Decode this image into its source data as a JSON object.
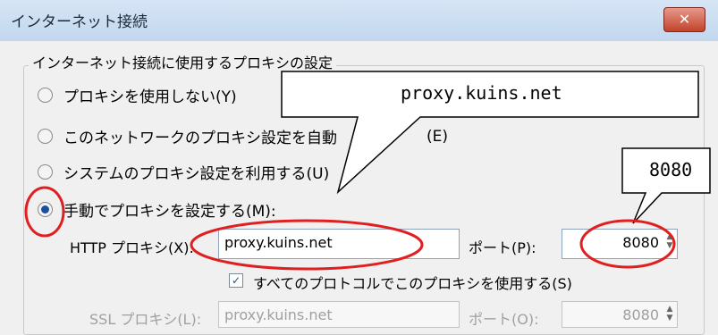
{
  "window": {
    "title": "インターネット接続",
    "close_glyph": "✕"
  },
  "group": {
    "title": "インターネット接続に使用するプロキシの設定"
  },
  "options": [
    {
      "label": "プロキシを使用しない(Y)",
      "checked": false
    },
    {
      "label": "このネットワークのプロキシ設定を自動",
      "trailing": "(E)",
      "checked": false
    },
    {
      "label": "システムのプロキシ設定を利用する(U)",
      "checked": false
    },
    {
      "label": "手動でプロキシを設定する(M):",
      "checked": true
    }
  ],
  "http": {
    "label": "HTTP プロキシ(X):",
    "host": "proxy.kuins.net",
    "port_label": "ポート(P):",
    "port": "8080"
  },
  "all_protocols": {
    "label": "すべてのプロトコルでこのプロキシを使用する(S)",
    "checked": true,
    "check_glyph": "✓"
  },
  "ssl": {
    "label": "SSL プロキシ(L):",
    "host": "proxy.kuins.net",
    "port_label": "ポート(O):",
    "port": "8080"
  },
  "annotations": {
    "host_callout": "proxy.kuins.net",
    "port_callout": "8080"
  },
  "colors": {
    "highlight": "#e02020",
    "radio_checked": "#1c4f9c",
    "titlebar": "#c8dcf0",
    "close_button": "#c3432a"
  }
}
